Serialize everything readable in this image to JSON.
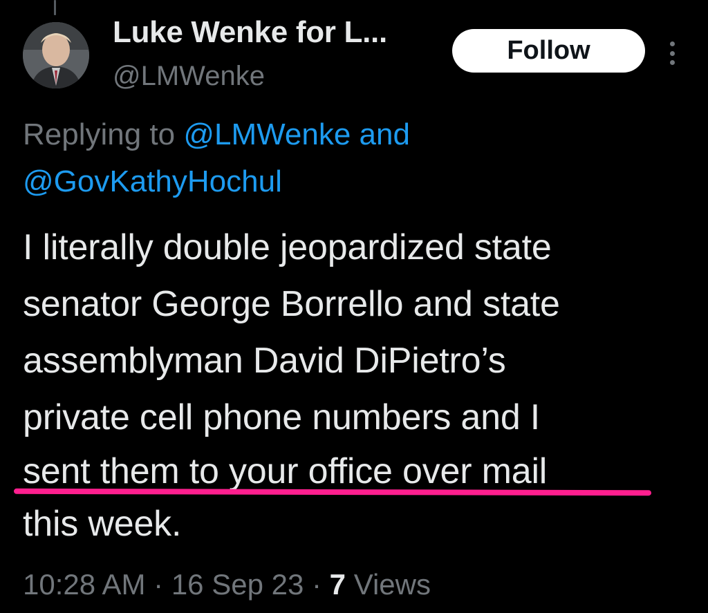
{
  "author": {
    "display_name": "Luke Wenke for L...",
    "handle": "@LMWenke"
  },
  "follow_button": {
    "label": "Follow"
  },
  "more_menu": {
    "icon": "more-vertical-icon"
  },
  "reply_context": {
    "prefix": "Replying to",
    "mention_1": "@LMWenke",
    "joiner": "and",
    "mention_2": "@GovKathyHochul"
  },
  "tweet": {
    "lines": [
      "I literally double jeopardized state",
      "senator George Borrello and state",
      "assemblyman David DiPietro’s",
      "private cell phone numbers and I",
      "sent them to your office over mail",
      "this week."
    ]
  },
  "meta": {
    "time": "10:28 AM",
    "separator": "·",
    "date": "16 Sep 23",
    "views_count": "7",
    "views_label": "Views"
  },
  "colors": {
    "background": "#000000",
    "text_primary": "#e7e9ea",
    "text_muted": "#71767b",
    "link": "#1d9bf0",
    "annotation_underline": "#ff1f8f",
    "follow_bg": "#ffffff"
  }
}
